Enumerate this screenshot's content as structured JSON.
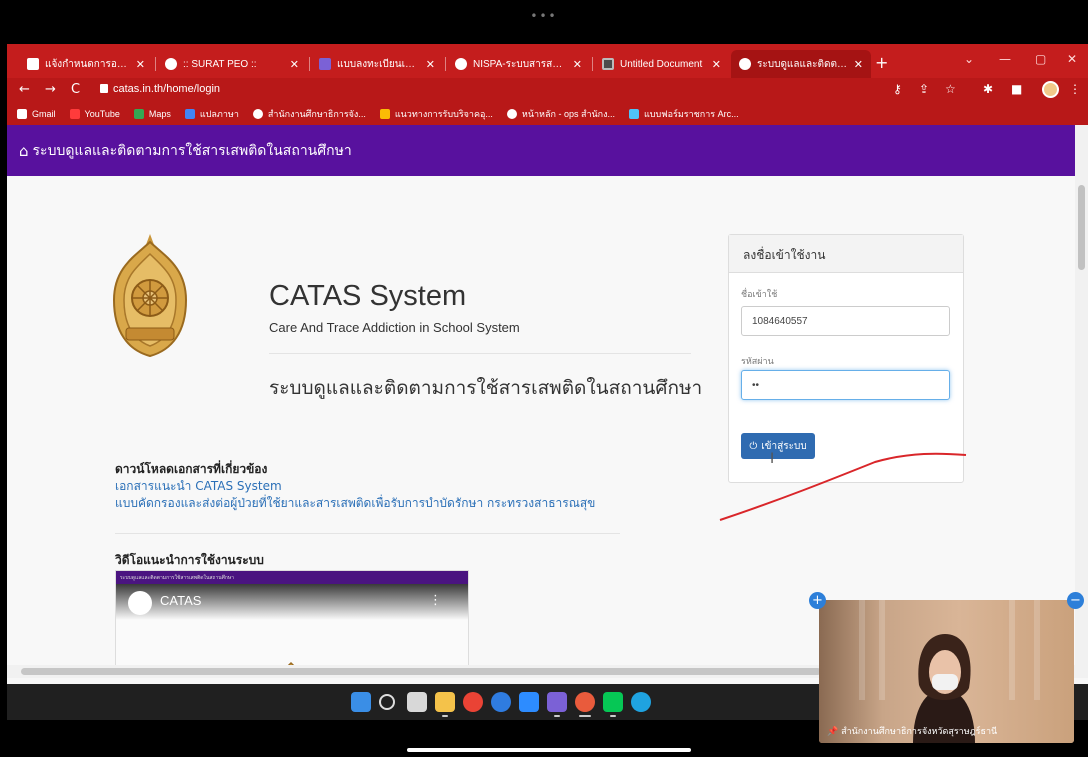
{
  "screen": {
    "dots": "•••"
  },
  "browser": {
    "tabs": [
      {
        "title": "แจ้งกำหนดการอบรมเชิ",
        "favicon_color": "#ffffff"
      },
      {
        "title": ":: SURAT PEO ::",
        "favicon_color": "#ffffff"
      },
      {
        "title": "แบบลงทะเบียนเพื่อรับเ",
        "favicon_color": "#7b61d6"
      },
      {
        "title": "NISPA-ระบบสารสนเทศ",
        "favicon_color": "#ffffff"
      },
      {
        "title": "Untitled Document",
        "favicon_color": "#4b4b4b"
      },
      {
        "title": "ระบบดูแลและติดตามการ",
        "favicon_color": "#ffffff",
        "active": true
      }
    ],
    "tab_close_glyph": "✕",
    "new_tab_glyph": "+",
    "url": "catas.in.th/home/login",
    "bookmarks": [
      {
        "label": "Gmail",
        "color": "#ffffff"
      },
      {
        "label": "YouTube",
        "color": "#ff3b3b"
      },
      {
        "label": "Maps",
        "color": "#34a853"
      },
      {
        "label": "แปลภาษา",
        "color": "#4285f4"
      },
      {
        "label": "สำนักงานศึกษาธิการจัง...",
        "color": "#ffffff"
      },
      {
        "label": "แนวทางการรับบริจาคอุ...",
        "color": "#fbbc05"
      },
      {
        "label": "หน้าหลัก - ops สำนักง...",
        "color": "#ffffff"
      },
      {
        "label": "แบบฟอร์มราชการ Arc...",
        "color": "#4fc3f7"
      }
    ]
  },
  "page": {
    "navbar_brand": "ระบบดูแลและติดตามการใช้สารเสพติดในสถานศึกษา",
    "system_title": "CATAS System",
    "system_subtitle": "Care And Trace Addiction in School System",
    "system_thai": "ระบบดูแลและติดตามการใช้สารเสพติดในสถานศึกษา",
    "downloads": {
      "heading": "ดาวน์โหลดเอกสารที่เกี่ยวข้อง",
      "links": [
        "เอกสารแนะนำ CATAS System",
        "แบบคัดกรองและส่งต่อผู้ป่วยที่ใช้ยาและสารเสพติดเพื่อรับการบำบัดรักษา กระทรวงสาธารณสุข"
      ]
    },
    "video": {
      "heading": "วิดีโอแนะนำการใช้งานระบบ",
      "channel_name": "CATAS",
      "menu_glyph": "⋮",
      "top_bar_text": "ระบบดูแลและติดตามการใช้สารเสพติดในสถานศึกษา"
    },
    "login": {
      "panel_title": "ลงชื่อเข้าใช้งาน",
      "username_label": "ชื่อเข้าใช้",
      "username_value": "1084640557",
      "password_label": "รหัสผ่าน",
      "password_value": "••",
      "button_label": "เข้าสู่ระบบ",
      "caret": "I"
    }
  },
  "video_tile": {
    "caption": "สำนักงานศึกษาธิการจังหวัดสุราษฎร์ธานี",
    "plus_glyph": "+",
    "minus_glyph": "−"
  },
  "colors": {
    "browser_red": "#c41d1d",
    "navbar_purple": "#58119e",
    "link_blue": "#2a6fb7",
    "button_blue": "#2f6bb1",
    "annotation_red": "#d9262a"
  }
}
